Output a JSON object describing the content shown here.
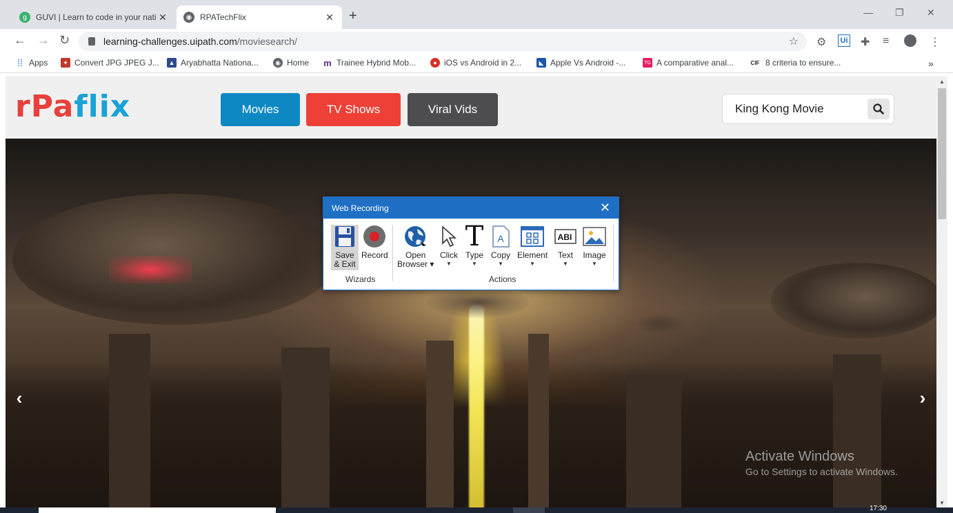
{
  "browser": {
    "tabs": [
      {
        "title": "GUVI | Learn to code in your nati",
        "favicon_color": "#3cb371",
        "active": false
      },
      {
        "title": "RPATechFlix",
        "favicon_color": "#5f6368",
        "active": true
      }
    ],
    "new_tab": "+",
    "window_controls": {
      "minimize": "—",
      "restore": "❐",
      "close": "✕"
    },
    "nav": {
      "back": "←",
      "forward": "→",
      "reload": "↻"
    },
    "url": {
      "host": "learning-challenges.uipath.com",
      "path": "/moviesearch/"
    },
    "bookmarks": [
      {
        "label": "Apps",
        "icon": "apps-grid-icon",
        "color": "#1a73e8"
      },
      {
        "label": "Convert JPG JPEG J...",
        "icon": "convert-icon",
        "color": "#c0392b"
      },
      {
        "label": "Aryabhatta Nationa...",
        "icon": "aryabhatta-icon",
        "color": "#2e4a8c"
      },
      {
        "label": "Home",
        "icon": "globe-icon",
        "color": "#5f6368"
      },
      {
        "label": "Trainee Hybrid Mob...",
        "icon": "m-logo-icon",
        "color": "#5b2c83"
      },
      {
        "label": "iOS vs Android in 2...",
        "icon": "ios-android-icon",
        "color": "#d93025"
      },
      {
        "label": "Apple Vs Android -...",
        "icon": "apple-android-icon",
        "color": "#1a56a8"
      },
      {
        "label": "A comparative anal...",
        "icon": "tg-icon",
        "color": "#e91e63"
      },
      {
        "label": "8 criteria to ensure...",
        "icon": "cif-icon",
        "color": "#222222"
      }
    ],
    "more_bookmarks": "»"
  },
  "site": {
    "logo": {
      "part1": "r",
      "part2": "Pa",
      "part3": "flix"
    },
    "nav": [
      {
        "label": "Movies",
        "color": "#0e88c2"
      },
      {
        "label": "TV Shows",
        "color": "#ee4036"
      },
      {
        "label": "Viral Vids",
        "color": "#4d4d4f"
      }
    ],
    "search": {
      "value": "King Kong Movie"
    },
    "carousel": {
      "prev": "‹",
      "next": "›"
    }
  },
  "watermark": {
    "title": "Activate Windows",
    "subtitle": "Go to Settings to activate Windows."
  },
  "taskbar": {
    "clock": "17:30"
  },
  "web_recording": {
    "title": "Web Recording",
    "close": "✕",
    "wizards_group": "Wizards",
    "actions_group": "Actions",
    "buttons": {
      "save_exit_l1": "Save",
      "save_exit_l2": "& Exit",
      "record": "Record",
      "open_browser_l1": "Open",
      "open_browser_l2": "Browser",
      "click": "Click",
      "type": "Type",
      "copy": "Copy",
      "element": "Element",
      "text": "Text",
      "image": "Image"
    },
    "colors": {
      "title_bar": "#1f6fc5",
      "record_dot": "#d92027"
    }
  }
}
